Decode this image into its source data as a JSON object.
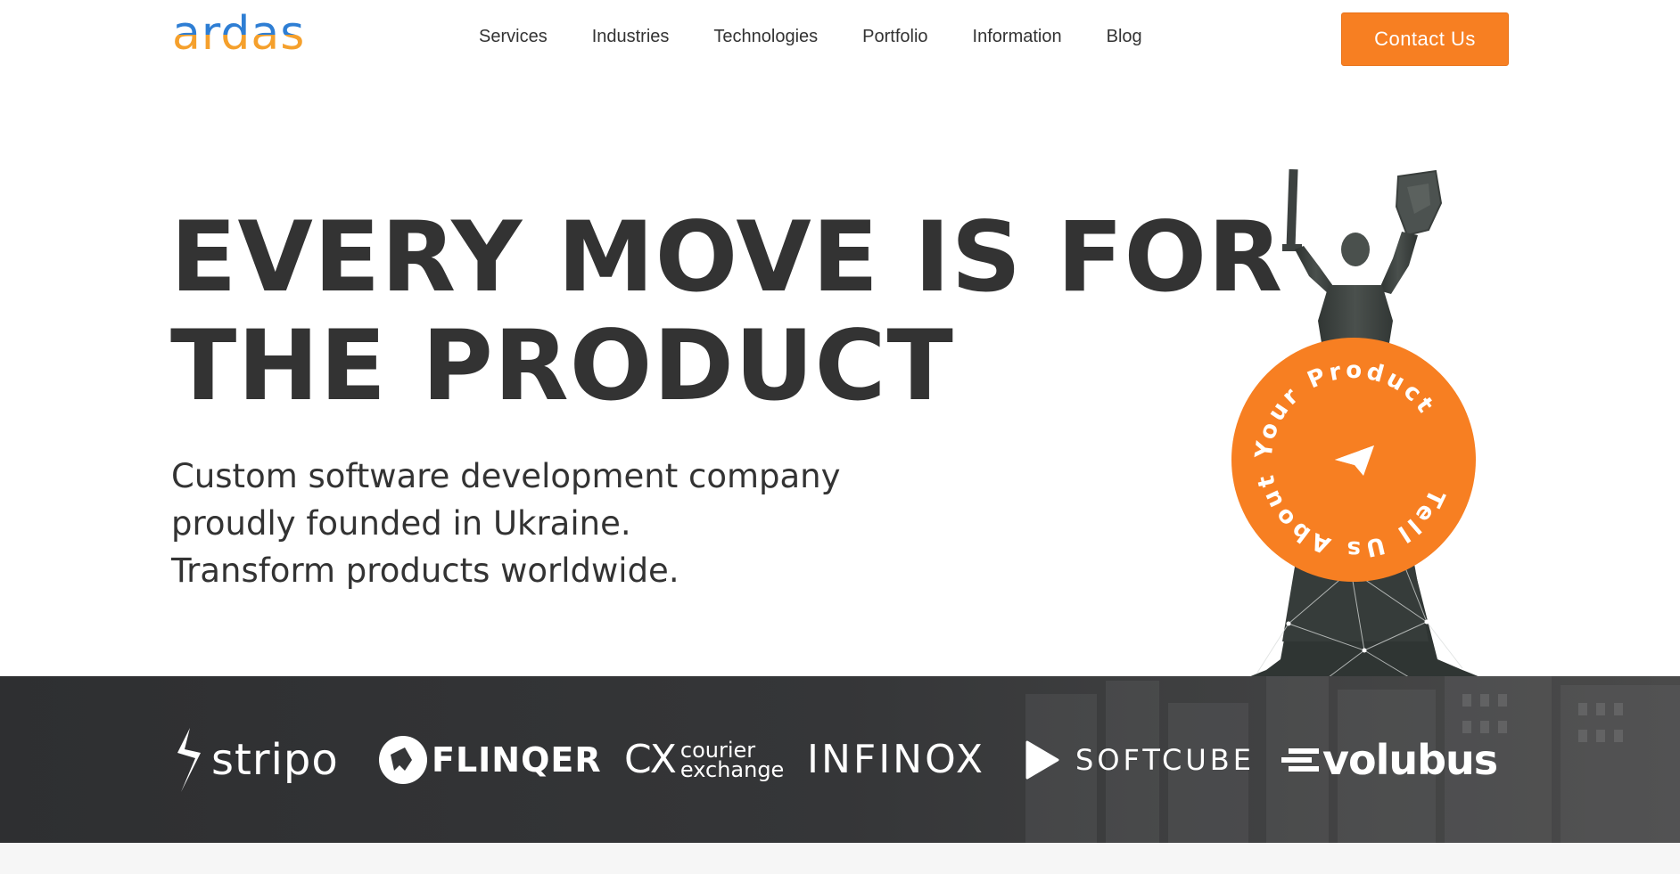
{
  "header": {
    "logo_text": "ardas",
    "nav": [
      {
        "label": "Services"
      },
      {
        "label": "Industries"
      },
      {
        "label": "Technologies"
      },
      {
        "label": "Portfolio"
      },
      {
        "label": "Information"
      },
      {
        "label": "Blog"
      }
    ],
    "contact_label": "Contact Us"
  },
  "hero": {
    "title_lines": [
      "EVERY MOVE IS FOR",
      "THE PRODUCT"
    ],
    "subtitle_lines": [
      "Custom software development company",
      "proudly founded in Ukraine.",
      "Transform products worldwide."
    ],
    "cta_circle_text": "Tell Us About Your Product",
    "cta_icon": "paper-plane-icon"
  },
  "clients": [
    {
      "name": "stripo"
    },
    {
      "name": "FLINQER"
    },
    {
      "name": "CX",
      "sub1": "courier",
      "sub2": "exchange"
    },
    {
      "name": "INFINOX"
    },
    {
      "name": "SOFTCUBE"
    },
    {
      "name": "volubus"
    }
  ],
  "colors": {
    "accent": "#f77f22",
    "text": "#333333",
    "logo_blue": "#2e7ed4",
    "logo_orange": "#f5a02c",
    "band": "#353638"
  }
}
